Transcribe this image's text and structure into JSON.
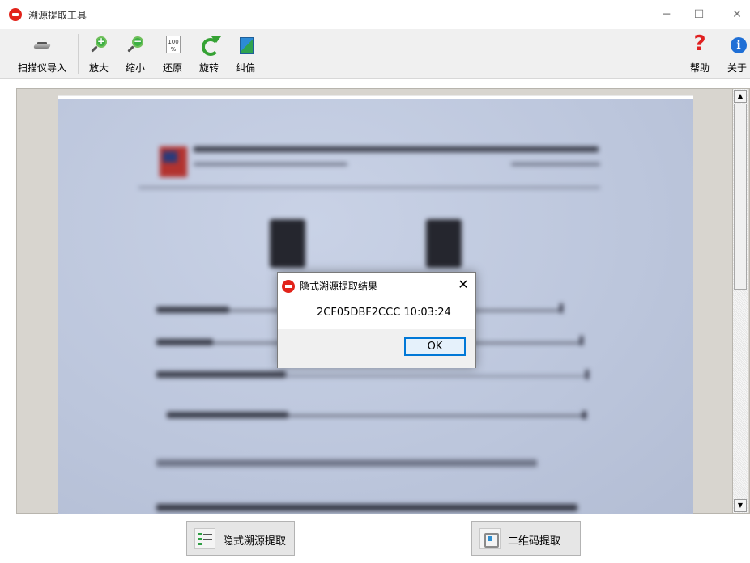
{
  "window": {
    "title": "溯源提取工具",
    "minimize": "─",
    "maximize": "☐",
    "close": "✕"
  },
  "toolbar": {
    "scan_import": "扫描仪导入",
    "zoom_in": "放大",
    "zoom_out": "缩小",
    "reset": "还原",
    "reset_icon_text": "100 %",
    "rotate": "旋转",
    "deskew": "纠偏",
    "help": "帮助",
    "about": "关于",
    "help_icon": "?",
    "about_icon": "i"
  },
  "buttons": {
    "hidden_trace_extract": "隐式溯源提取",
    "qrcode_extract": "二维码提取"
  },
  "dialog": {
    "title": "隐式溯源提取结果",
    "message": "2CF05DBF2CCC 10:03:24",
    "ok_label": "OK",
    "close": "✕"
  },
  "scrollbar": {
    "up": "▲",
    "down": "▼"
  },
  "colors": {
    "brand_red": "#e2231a",
    "accent_blue": "#0078d7",
    "toolbar_bg": "#f0f0f0"
  }
}
